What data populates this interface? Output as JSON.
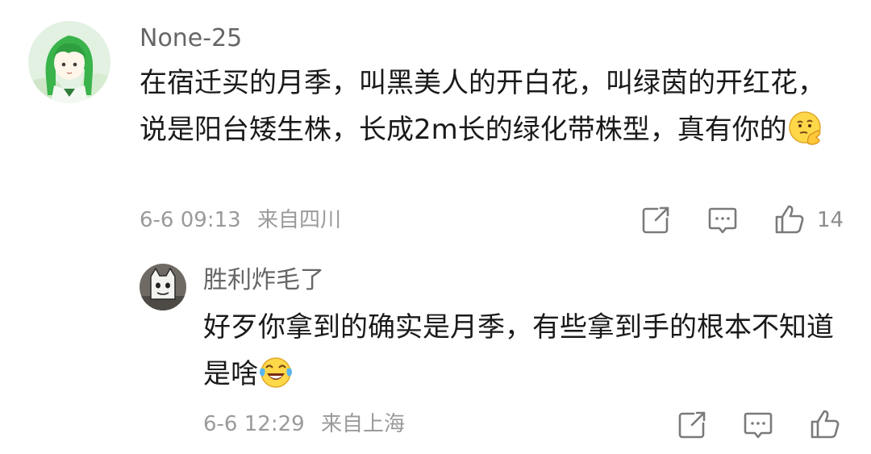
{
  "comments": [
    {
      "username": "None-25",
      "text": "在宿迁买的月季，叫黑美人的开白花，叫绿茵的开红花，说是阳台矮生株，长成2m长的绿化带株型，真有你的",
      "emoji": "thinking-face-emoji",
      "time": "6-6 09:13",
      "location": "来自四川",
      "like_count": "14",
      "reply": {
        "username": "胜利炸毛了",
        "text": "好歹你拿到的确实是月季，有些拿到手的根本不知道是啥",
        "emoji": "laughing-tears-emoji",
        "time": "6-6 12:29",
        "location": "来自上海",
        "like_count": ""
      }
    }
  ],
  "icons": {
    "share": "share-icon",
    "reply": "comment-icon",
    "like": "thumbs-up-icon"
  },
  "colors": {
    "text": "#1a1a1a",
    "username": "#666666",
    "meta": "#9a9a9a",
    "icon": "#7a7a7a",
    "avatar_main_bg": "#e2f1e1",
    "hair_green": "#39b34a"
  }
}
